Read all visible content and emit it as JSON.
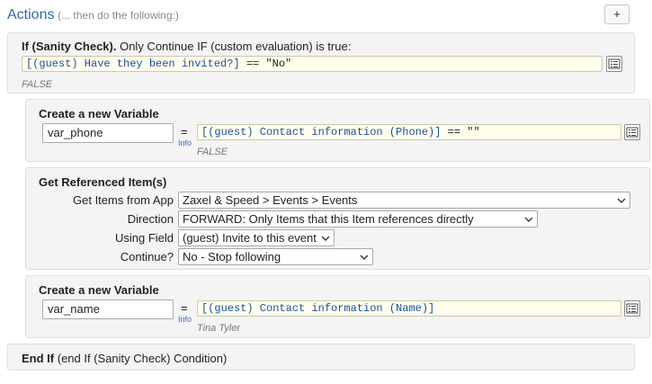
{
  "header": {
    "title": "Actions",
    "subtitle": "(... then do the following:)",
    "add_label": "+"
  },
  "if_block": {
    "title": "If (Sanity Check).",
    "desc": "Only Continue IF (custom evaluation) is true:",
    "expr_guest": "[(guest) Have they been invited?]",
    "expr_rest": " == \"No\"",
    "result": "FALSE"
  },
  "var_phone": {
    "title": "Create a new Variable",
    "name": "var_phone",
    "equals": "=",
    "info": "Info",
    "expr_guest": "[(guest) Contact information (Phone)]",
    "expr_rest": " == \"\"",
    "result": "FALSE"
  },
  "ref_items": {
    "title": "Get Referenced Item(s)",
    "rows": [
      {
        "label": "Get Items from App",
        "value": "Zaxel & Speed > Events > Events"
      },
      {
        "label": "Direction",
        "value": "FORWARD: Only Items that this Item references directly"
      },
      {
        "label": "Using Field",
        "value": "(guest) Invite to this event"
      },
      {
        "label": "Continue?",
        "value": "No - Stop following"
      }
    ]
  },
  "var_name": {
    "title": "Create a new Variable",
    "name": "var_name",
    "equals": "=",
    "info": "Info",
    "expr_guest": "[(guest) Contact information (Name)]",
    "result": "Tina Tyler"
  },
  "end_if": {
    "title": "End If",
    "desc": "(end If (Sanity Check) Condition)"
  },
  "colors": {
    "title_blue": "#2f67b4",
    "expr_bg": "#fffdeb",
    "panel_bg": "#f4f4f4"
  }
}
